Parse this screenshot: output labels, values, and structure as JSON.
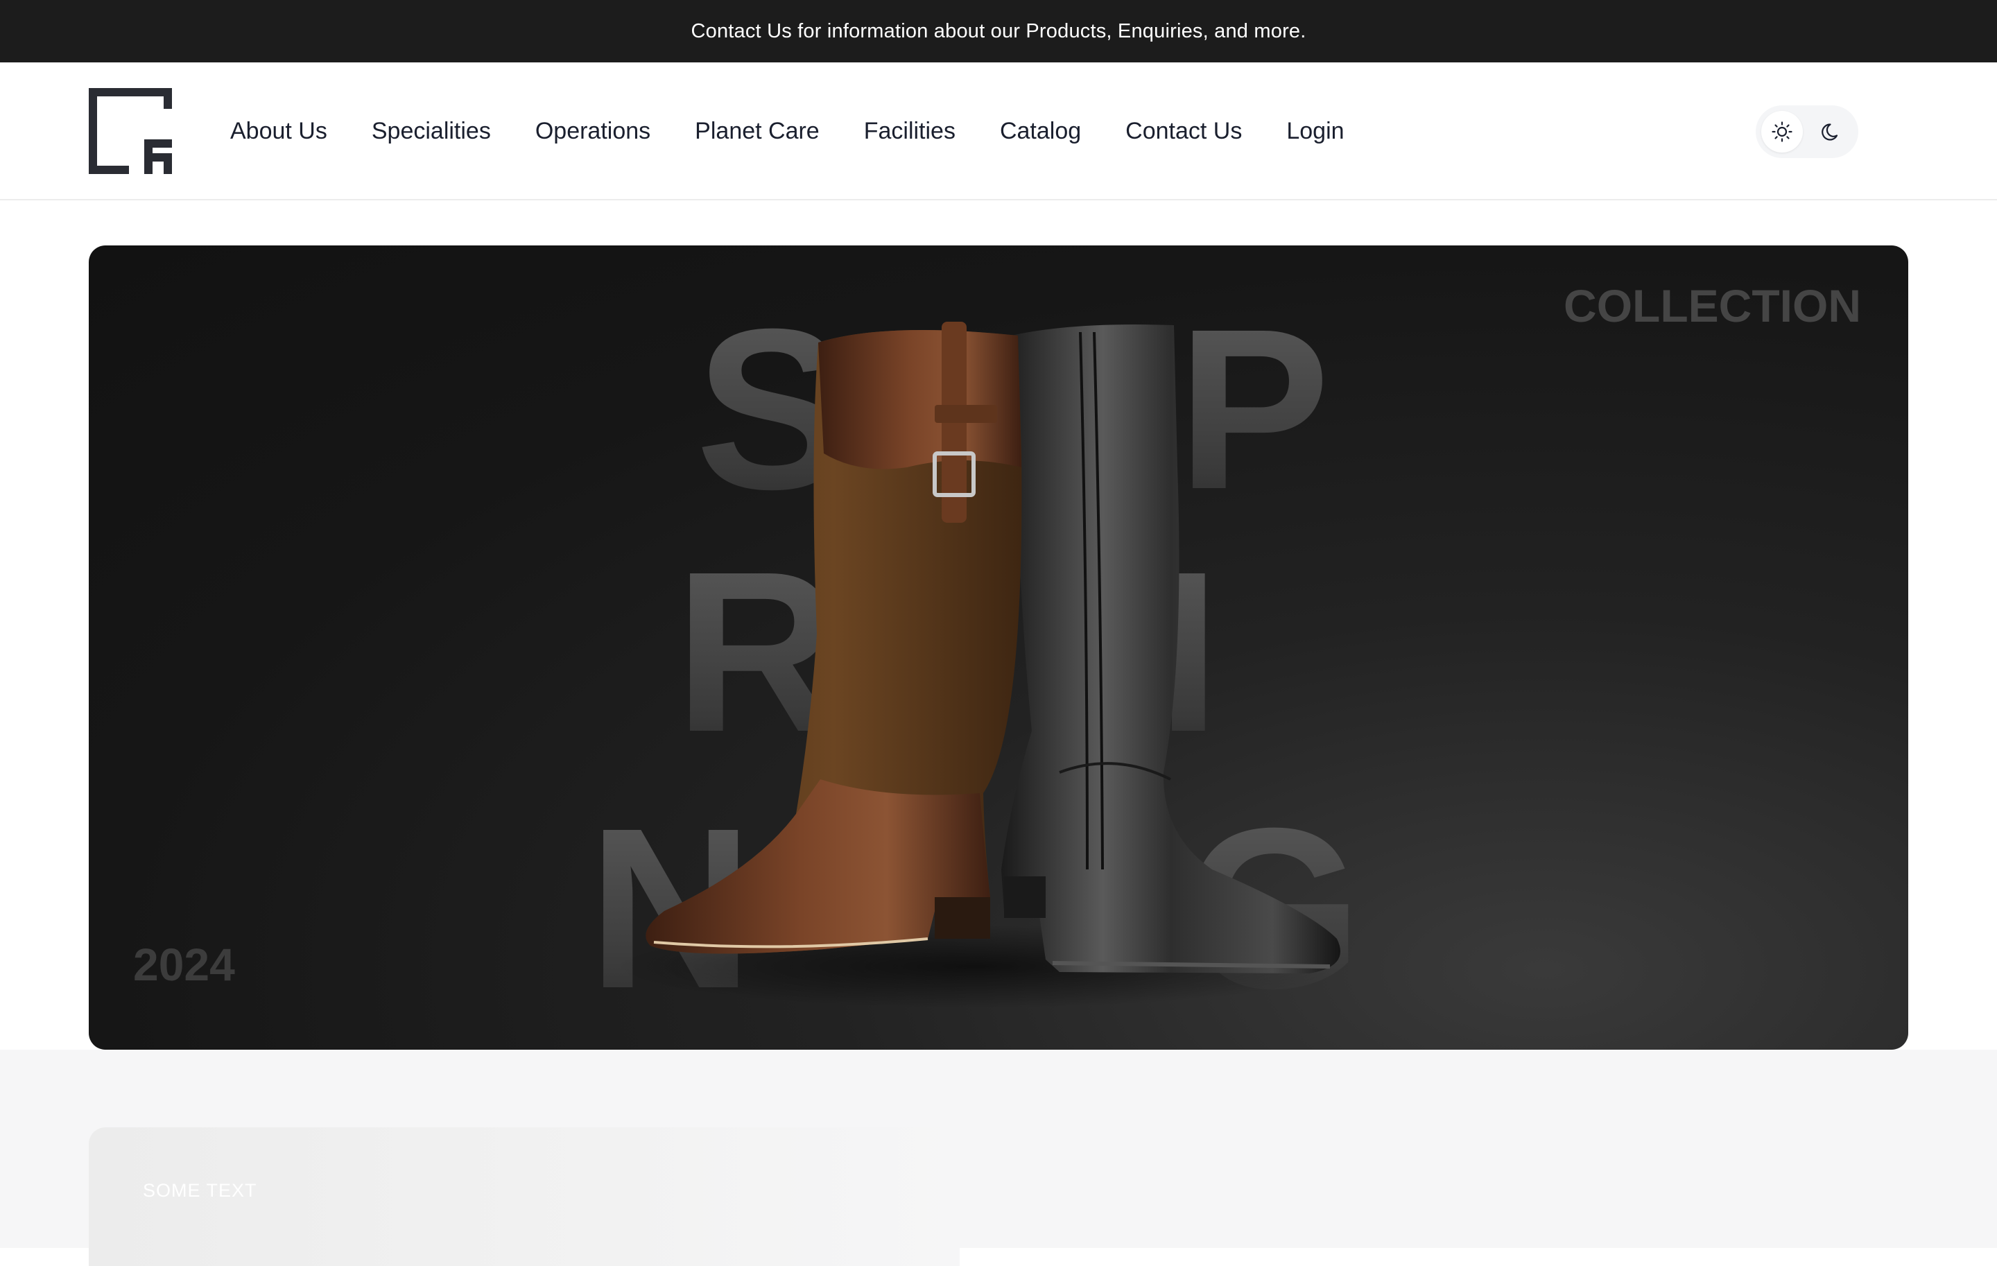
{
  "announcement": {
    "text": "Contact Us for information about our Products, Enquiries, and more."
  },
  "nav": {
    "items": [
      {
        "label": "About Us"
      },
      {
        "label": "Specialities"
      },
      {
        "label": "Operations"
      },
      {
        "label": "Planet Care"
      },
      {
        "label": "Facilities"
      },
      {
        "label": "Catalog"
      },
      {
        "label": "Contact Us"
      },
      {
        "label": "Login"
      }
    ]
  },
  "theme": {
    "light_icon": "sun-icon",
    "dark_icon": "moon-icon",
    "active": "light"
  },
  "hero": {
    "letters": [
      "S",
      "P",
      "R",
      "I",
      "N",
      "G"
    ],
    "label_collection": "COLLECTION",
    "label_year": "2024"
  },
  "lower": {
    "card_text": "SOME TEXT"
  },
  "colors": {
    "topbar_bg": "#1c1c1c",
    "nav_text": "#1a1f2e",
    "hero_bg": "#161616",
    "hero_letter": "#555555",
    "boot_brown": "#6b3a22",
    "boot_suede": "#5a3a1e",
    "boot_black": "#2b2b2b"
  }
}
